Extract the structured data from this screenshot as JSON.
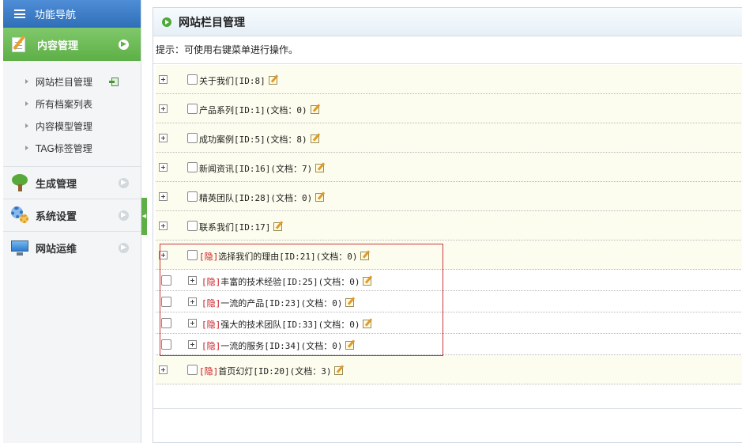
{
  "sidebar": {
    "header": "功能导航",
    "active_section": "内容管理",
    "sub_items": [
      "网站栏目管理",
      "所有档案列表",
      "内容模型管理",
      "TAG标签管理"
    ],
    "sections": [
      "生成管理",
      "系统设置",
      "网站运维"
    ]
  },
  "main": {
    "title": "网站栏目管理",
    "hint": "提示：可使用右键菜单进行操作。"
  },
  "tree": {
    "top": [
      {
        "name": "关于我们",
        "id_text": "[ID:8]",
        "doc": ""
      },
      {
        "name": "产品系列",
        "id_text": "[ID:1]",
        "doc": "(文档：0)"
      },
      {
        "name": "成功案例",
        "id_text": "[ID:5]",
        "doc": "(文档：8)"
      },
      {
        "name": "新闻资讯",
        "id_text": "[ID:16]",
        "doc": "(文档：7)"
      },
      {
        "name": "精英团队",
        "id_text": "[ID:28]",
        "doc": "(文档：0)"
      },
      {
        "name": "联系我们",
        "id_text": "[ID:17]",
        "doc": ""
      },
      {
        "hidden": "[隐]",
        "name": "选择我们的理由",
        "id_text": "[ID:21]",
        "doc": "(文档：0)"
      }
    ],
    "children": [
      {
        "hidden": "[隐]",
        "name": "丰富的技术经验",
        "id_text": "[ID:25]",
        "doc": "(文档：0)"
      },
      {
        "hidden": "[隐]",
        "name": "一流的产品",
        "id_text": "[ID:23]",
        "doc": "(文档：0)"
      },
      {
        "hidden": "[隐]",
        "name": "强大的技术团队",
        "id_text": "[ID:33]",
        "doc": "(文档：0)"
      },
      {
        "hidden": "[隐]",
        "name": "一流的服务",
        "id_text": "[ID:34]",
        "doc": "(文档：0)"
      }
    ],
    "last": {
      "hidden": "[隐]",
      "name": "首页幻灯",
      "id_text": "[ID:20]",
      "doc": "(文档：3)"
    }
  }
}
